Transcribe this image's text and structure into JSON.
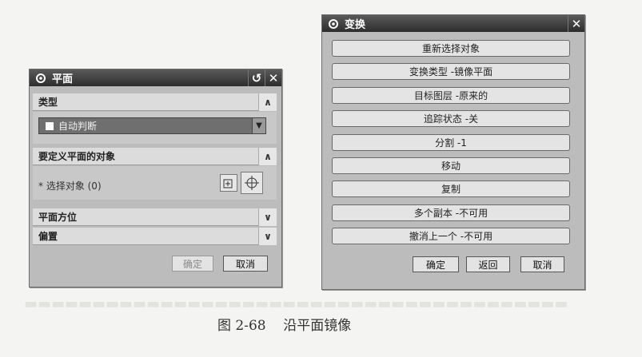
{
  "plane_dialog": {
    "title": "平面",
    "sections": [
      {
        "label": "类型"
      },
      {
        "label": "要定义平面的对象"
      },
      {
        "label": "平面方位"
      },
      {
        "label": "偏置"
      }
    ],
    "type_select_value": "自动判断",
    "select_object_label": "* 选择对象 (0)",
    "ok_label": "确定",
    "cancel_label": "取消"
  },
  "transform_dialog": {
    "title": "变换",
    "options": [
      "重新选择对象",
      "变换类型 -镜像平面",
      "目标图层 -原来的",
      "追踪状态 -关",
      "分割 -1",
      "移动",
      "复制",
      "多个副本 -不可用",
      "撤消上一个 -不可用"
    ],
    "ok_label": "确定",
    "back_label": "返回",
    "cancel_label": "取消"
  },
  "caption": "图 2-68    沿平面镜像"
}
